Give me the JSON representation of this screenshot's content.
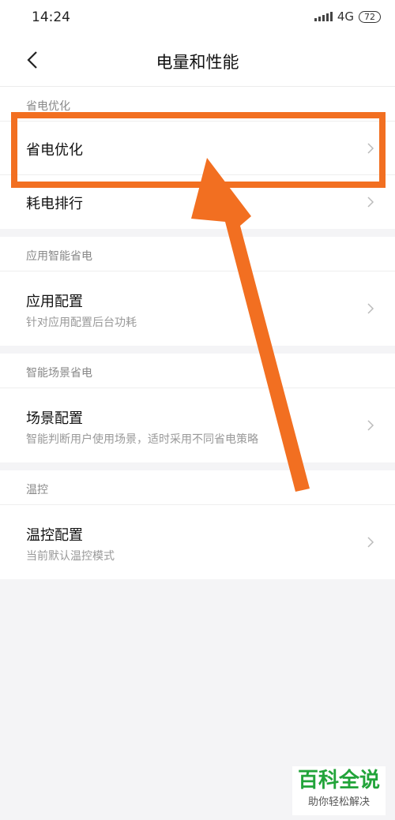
{
  "status": {
    "time": "14:24",
    "network": "4G",
    "battery": "72"
  },
  "header": {
    "title": "电量和性能"
  },
  "sections": [
    {
      "header": "省电优化",
      "items": [
        {
          "title": "省电优化"
        },
        {
          "title": "耗电排行"
        }
      ]
    },
    {
      "header": "应用智能省电",
      "items": [
        {
          "title": "应用配置",
          "subtitle": "针对应用配置后台功耗"
        }
      ]
    },
    {
      "header": "智能场景省电",
      "items": [
        {
          "title": "场景配置",
          "subtitle": "智能判断用户使用场景，适时采用不同省电策略"
        }
      ]
    },
    {
      "header": "温控",
      "items": [
        {
          "title": "温控配置",
          "subtitle": "当前默认温控模式"
        }
      ]
    }
  ],
  "watermark": {
    "title": "百科全说",
    "subtitle": "助你轻松解决"
  },
  "colors": {
    "highlight": "#f26f21",
    "watermark_green": "#22a43a"
  }
}
